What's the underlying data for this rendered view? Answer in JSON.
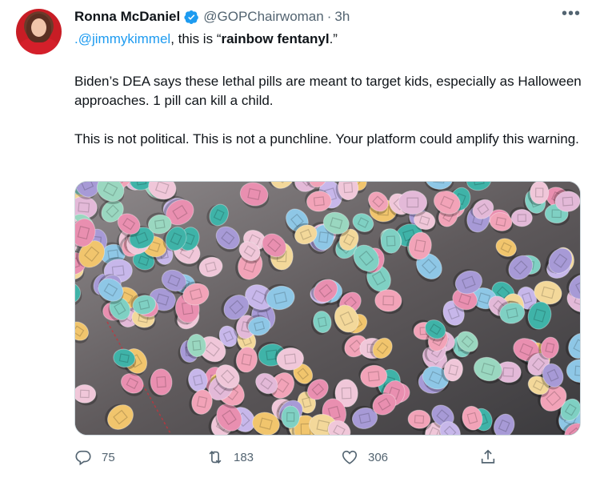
{
  "tweet": {
    "author_name": "Ronna McDaniel",
    "handle": "@GOPChairwoman",
    "separator": "·",
    "time": "3h",
    "more_label": "•••",
    "line1_mention": ".@jimmykimmel",
    "line1_mid": ", this is ",
    "line1_quote_open": "“",
    "line1_bold": "rainbow fentanyl",
    "line1_quote_close": ".”",
    "paragraph2": "Biden’s DEA says these lethal pills are meant to target kids, especially as Halloween approaches. 1 pill can kill a child.",
    "paragraph3": "This is not political. This is not a punchline. Your platform could amplify this warning."
  },
  "actions": {
    "reply_count": "75",
    "retweet_count": "183",
    "like_count": "306"
  },
  "icons": [
    "verified-icon",
    "more-icon",
    "reply-icon",
    "retweet-icon",
    "like-icon",
    "share-icon"
  ],
  "colors": {
    "accent": "#1d9bf0",
    "text": "#0f1419",
    "secondary": "#536471"
  },
  "pill_colors": [
    "#e98fb0",
    "#f0c7d9",
    "#7fd0c3",
    "#3fb3a8",
    "#f1c56d",
    "#f3d89a",
    "#a79ad6",
    "#c7b7ea",
    "#8ec7e6",
    "#f2a3b8",
    "#e3b9d8",
    "#9ad7c0"
  ]
}
